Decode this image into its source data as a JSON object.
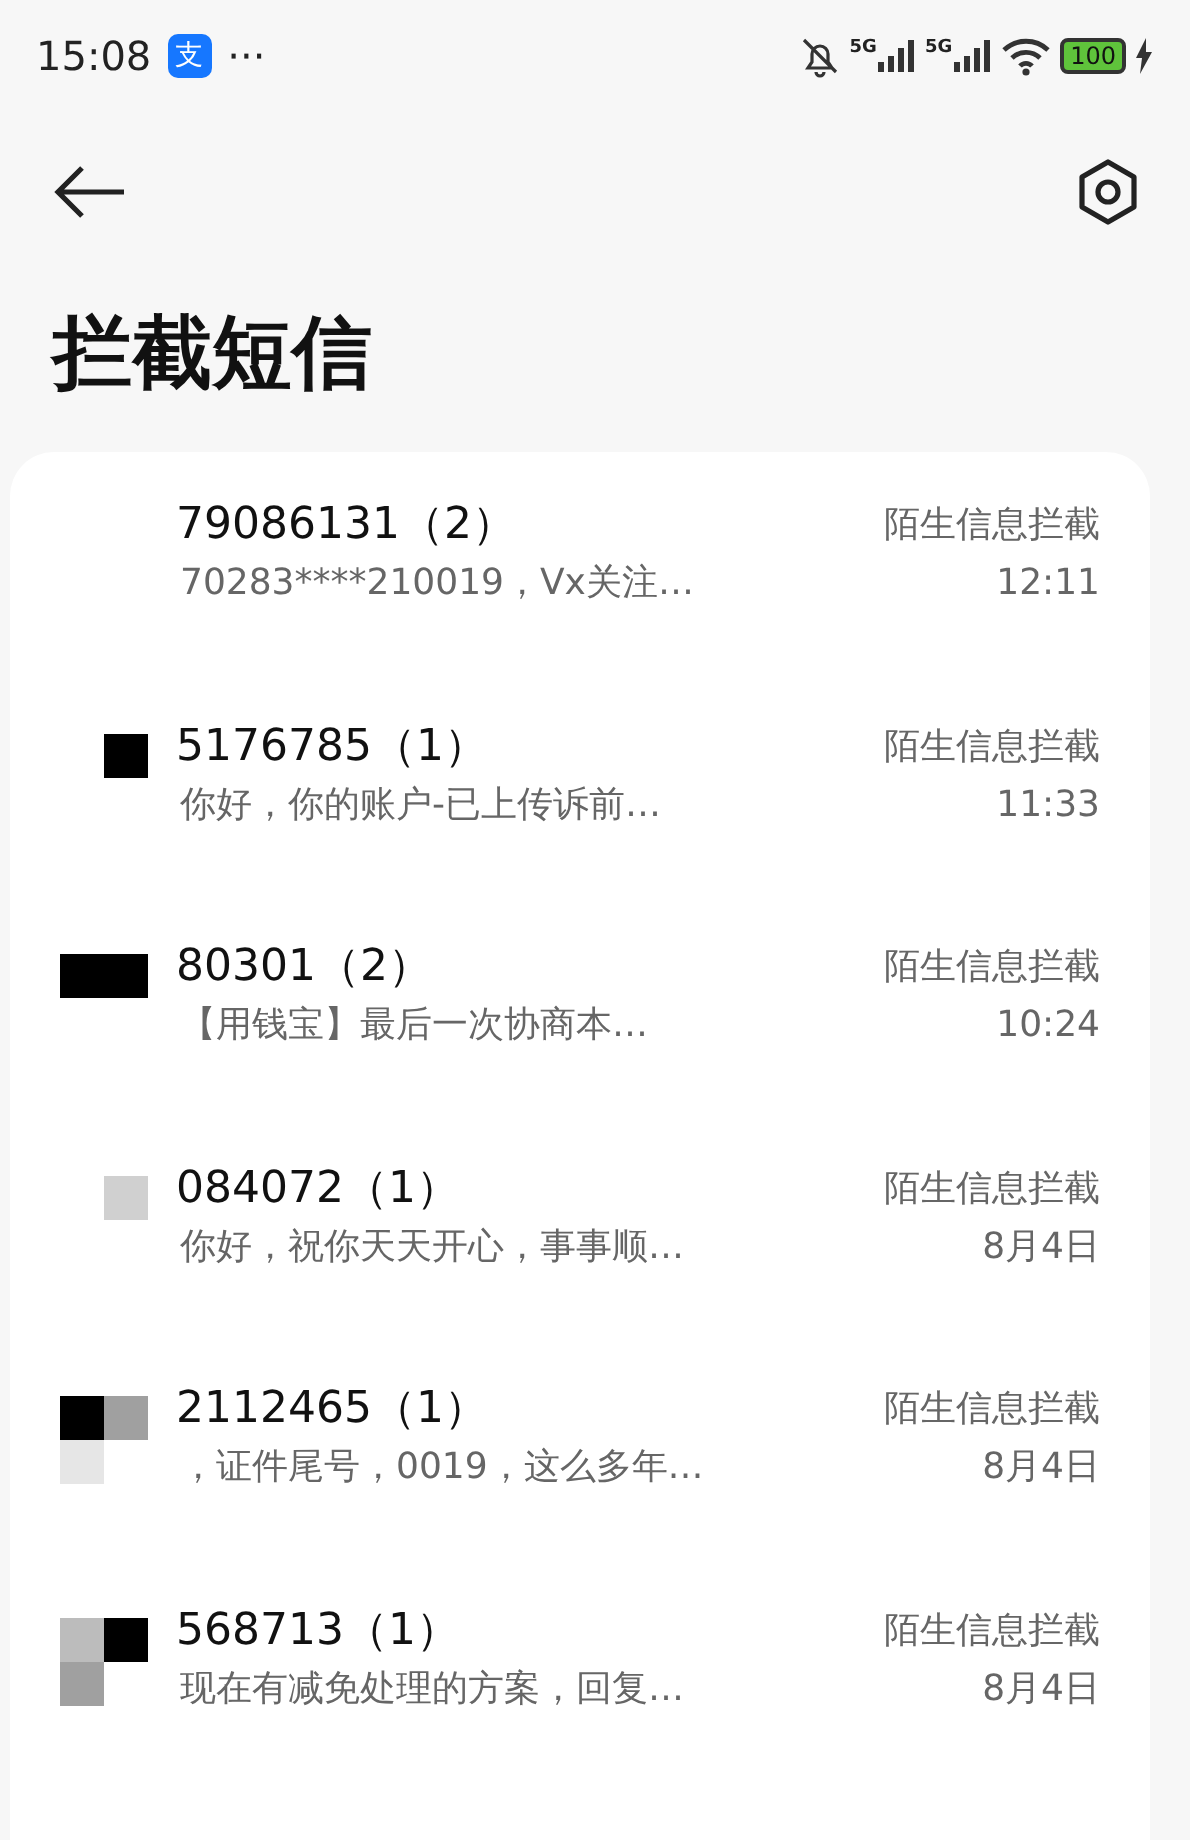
{
  "status_bar": {
    "time": "15:08",
    "app_badge": "支",
    "more": "···",
    "networks": [
      {
        "label": "5G"
      },
      {
        "label": "5G"
      }
    ],
    "battery": "100"
  },
  "header": {
    "title": "拦截短信"
  },
  "messages": [
    {
      "sender": "79086131（2）",
      "preview": "70283****210019，Vx关注…",
      "tag": "陌生信息拦截",
      "time": "12:11"
    },
    {
      "sender": "5176785（1）",
      "preview": "你好，你的账户-已上传诉前…",
      "tag": "陌生信息拦截",
      "time": "11:33",
      "redaction": [
        {
          "kind": "blank"
        },
        {
          "kind": "filled",
          "color": "#000000"
        }
      ]
    },
    {
      "sender": "80301（2）",
      "preview": "【用钱宝】最后一次协商本…",
      "tag": "陌生信息拦截",
      "time": "10:24",
      "redaction": [
        {
          "kind": "filled",
          "color": "#000000"
        },
        {
          "kind": "filled",
          "color": "#000000"
        }
      ]
    },
    {
      "sender": "084072（1）",
      "preview": "你好，祝你天天开心，事事顺…",
      "tag": "陌生信息拦截",
      "time": "8月4日",
      "redaction": [
        {
          "kind": "blank"
        },
        {
          "kind": "filled",
          "color": "#d0d0d0"
        }
      ]
    },
    {
      "sender": "2112465（1）",
      "preview": "，证件尾号，0019，这么多年…",
      "tag": "陌生信息拦截",
      "time": "8月4日",
      "redaction": [
        {
          "kind": "filled",
          "color": "#000000"
        },
        {
          "kind": "filled",
          "color": "#a0a0a0"
        },
        {
          "kind": "filled",
          "color": "#e6e6e6"
        }
      ]
    },
    {
      "sender": "568713（1）",
      "preview": "现在有减免处理的方案，回复…",
      "tag": "陌生信息拦截",
      "time": "8月4日",
      "redaction": [
        {
          "kind": "filled",
          "color": "#bcbcbc"
        },
        {
          "kind": "filled",
          "color": "#000000"
        },
        {
          "kind": "filled",
          "color": "#a0a0a0"
        }
      ]
    }
  ]
}
